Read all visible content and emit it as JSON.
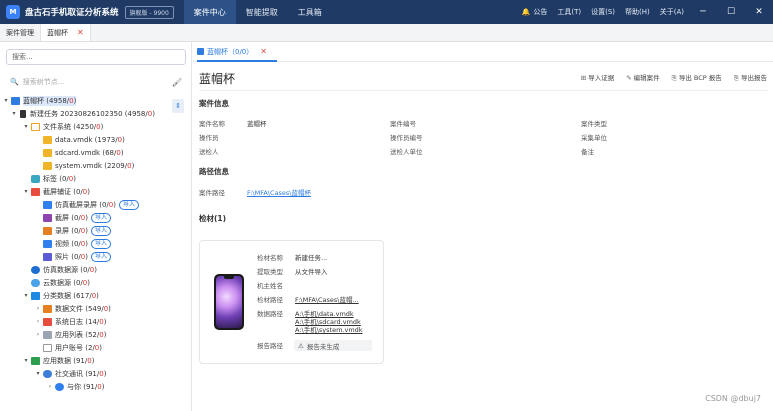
{
  "titlebar": {
    "logo": "M",
    "app_title": "盘古石手机取证分析系统",
    "edition": "旗舰版 - 9900",
    "menu": [
      "案件中心",
      "智能提取",
      "工具箱"
    ],
    "right": {
      "notice": "公告",
      "tools": "工具(T)",
      "settings": "设置(S)",
      "help": "帮助(H)",
      "about": "关于(A)"
    }
  },
  "tabs": [
    {
      "label": "案件管理"
    },
    {
      "label": "蓝帽杯"
    }
  ],
  "left": {
    "search_placeholder": "搜索...",
    "search_node_placeholder": "搜索树节点..."
  },
  "tree": [
    {
      "label": "蓝帽杯 (4958/",
      "cnt": "0",
      "tail": ")"
    },
    {
      "label": "新建任务 20230826102350 (4958/",
      "cnt": "0",
      "tail": ")"
    },
    {
      "label": "文件系统 (4250/",
      "cnt": "0",
      "tail": ")"
    },
    {
      "label": "data.vmdk (1973/",
      "cnt": "0",
      "tail": ")"
    },
    {
      "label": "sdcard.vmdk (68/",
      "cnt": "0",
      "tail": ")"
    },
    {
      "label": "system.vmdk (2209/",
      "cnt": "0",
      "tail": ")"
    },
    {
      "label": "标签 (0/",
      "cnt": "0",
      "tail": ")"
    },
    {
      "label": "截屏辅证 (0/",
      "cnt": "0",
      "tail": ")"
    },
    {
      "label": "仿真截屏录屏 (0/",
      "cnt": "0",
      "tail": ")",
      "import": "导入"
    },
    {
      "label": "截屏 (0/",
      "cnt": "0",
      "tail": ")",
      "import": "导入"
    },
    {
      "label": "录屏 (0/",
      "cnt": "0",
      "tail": ")",
      "import": "导入"
    },
    {
      "label": "视频 (0/",
      "cnt": "0",
      "tail": ")",
      "import": "导入"
    },
    {
      "label": "照片 (0/",
      "cnt": "0",
      "tail": ")",
      "import": "导入"
    },
    {
      "label": "仿真数据源 (0/",
      "cnt": "0",
      "tail": ")"
    },
    {
      "label": "云数据源 (0/",
      "cnt": "0",
      "tail": ")"
    },
    {
      "label": "分类数据 (617/",
      "cnt": "0",
      "tail": ")"
    },
    {
      "label": "数据文件 (549/",
      "cnt": "0",
      "tail": ")"
    },
    {
      "label": "系统日志 (14/",
      "cnt": "0",
      "tail": ")"
    },
    {
      "label": "应用列表 (52/",
      "cnt": "0",
      "tail": ")"
    },
    {
      "label": "用户账号 (2/",
      "cnt": "0",
      "tail": ")"
    },
    {
      "label": "应用数据 (91/",
      "cnt": "0",
      "tail": ")"
    },
    {
      "label": "社交通讯 (91/",
      "cnt": "0",
      "tail": ")"
    },
    {
      "label": "与你 (91/",
      "cnt": "0",
      "tail": ")"
    }
  ],
  "right": {
    "tab_label": "蓝帽杯（0/0）",
    "case_title": "蓝帽杯",
    "actions": [
      "导入证据",
      "编辑案件",
      "导出 BCP 报告",
      "导出报告"
    ],
    "case_info_header": "案件信息",
    "fields": {
      "case_name_k": "案件名称",
      "case_name_v": "蓝帽杯",
      "case_no_k": "案件编号",
      "case_type_k": "案件类型",
      "operator_k": "操作员",
      "operator_no_k": "操作员编号",
      "collect_unit_k": "采集单位",
      "sender_k": "送检人",
      "sender_unit_k": "送检人单位",
      "remark_k": "备注"
    },
    "path_header": "路径信息",
    "case_path_k": "案件路径",
    "case_path_v": "F:\\MFA\\Cases\\蓝帽杯",
    "material_header": "检材(1)",
    "card": {
      "name_k": "检材名称",
      "name_v": "新建任务...",
      "type_k": "提取类型",
      "type_v": "从文件导入",
      "owner_k": "机主姓名",
      "owner_v": "",
      "mpath_k": "检材路径",
      "mpath_v": "F:\\MFA\\Cases\\蓝帽...",
      "dpath_k": "数据路径",
      "dpaths": [
        "A:\\手机\\data.vmdk",
        "A:\\手机\\sdcard.vmdk",
        "A:\\手机\\system.vmdk"
      ],
      "report_k": "报告路径",
      "report_v": "报告未生成"
    }
  },
  "watermark": "CSDN @dbuj7"
}
